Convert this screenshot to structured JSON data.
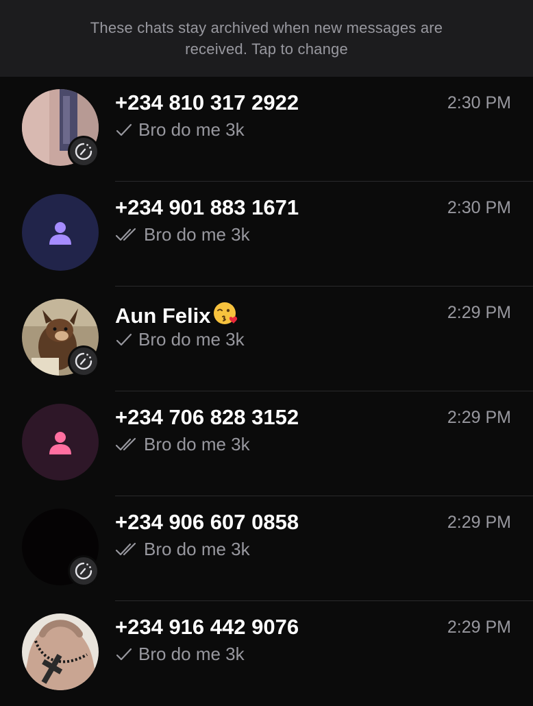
{
  "banner": {
    "text": "These chats stay archived when new messages are received. Tap to change"
  },
  "chats": [
    {
      "name": "+234 810 317 2922",
      "time": "2:30 PM",
      "preview": "Bro do me 3k",
      "ticks": "single",
      "avatar": "photo-wall",
      "status_badge": true
    },
    {
      "name": "+234 901 883 1671",
      "time": "2:30 PM",
      "preview": "Bro do me 3k",
      "ticks": "double",
      "avatar": "placeholder",
      "avatar_color": "#21244a",
      "icon_color": "#a58cff",
      "status_badge": false
    },
    {
      "name": "Aun Felix",
      "time": "2:29 PM",
      "preview": "Bro do me 3k",
      "ticks": "single",
      "avatar": "photo-dog",
      "status_badge": true,
      "name_emoji": "kissing-face-emoji"
    },
    {
      "name": "+234 706 828 3152",
      "time": "2:29 PM",
      "preview": "Bro do me 3k",
      "ticks": "double",
      "avatar": "placeholder",
      "avatar_color": "#2e1728",
      "icon_color": "#ff6fa0",
      "status_badge": false
    },
    {
      "name": "+234 906 607 0858",
      "time": "2:29 PM",
      "preview": "Bro do me 3k",
      "ticks": "double",
      "avatar": "photo-dark",
      "status_badge": true
    },
    {
      "name": "+234 916 442 9076",
      "time": "2:29 PM",
      "preview": "Bro do me 3k",
      "ticks": "single",
      "avatar": "photo-hands",
      "status_badge": false
    }
  ]
}
